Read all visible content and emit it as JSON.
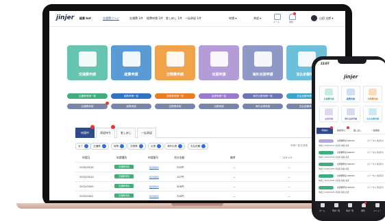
{
  "header": {
    "logo": "jinjer",
    "product": "経費 bot",
    "nav_active": "交通費ページ",
    "links": [
      "交通費 1件",
      "経費申請 1件",
      "差し戻し 1件",
      "一括承認 1件"
    ],
    "user_menu": "申請 ▾",
    "mode_menu": "承認 ▾",
    "icon_captions": [
      "ホーム",
      "通知"
    ],
    "user_name": "山田 太郎 ▾"
  },
  "tiles": [
    {
      "label": "交通費申請",
      "list": "交通費申請一覧",
      "approve": "交通費承認",
      "color": "#66c4b0",
      "pill": "#3fae7e",
      "pill2": "#7a86a8",
      "icon": "train-icon"
    },
    {
      "label": "経費申請",
      "list": "経費申請一覧",
      "approve": "経費承認",
      "color": "#5a9bd6",
      "pill": "#2f72c4",
      "pill2": "#7a86a8",
      "icon": "camera-icon"
    },
    {
      "label": "交際費申請",
      "list": "交際費申請一覧",
      "approve": "交際費承認",
      "color": "#f0a24c",
      "pill": "#ea7d22",
      "pill2": "#7a86a8",
      "icon": "store-icon"
    },
    {
      "label": "出張申請",
      "list": "出張申請一覧",
      "approve": "出張承認",
      "color": "#b49cd8",
      "pill": "#9b79cc",
      "pill2": "#7a86a8",
      "icon": "briefcase-icon"
    },
    {
      "label": "海外出張申請",
      "list": "海外出張申請一覧",
      "approve": "海外出張承認",
      "color": "#8f98c6",
      "pill": "#6b76b3",
      "pill2": "#7a86a8",
      "icon": "plane-icon"
    },
    {
      "label": "支払依頼申請",
      "list": "支払依頼申請一覧",
      "approve": "支払依頼承認",
      "color": "#6cc0dc",
      "pill": "#3aa6cc",
      "pill2": "#7a86a8",
      "icon": "document-icon"
    }
  ],
  "tabs": [
    "申請中",
    "承認待ち",
    "差し戻し",
    "一括承認"
  ],
  "filters": [
    "全て",
    "交通費",
    "経費",
    "交際費",
    "出張",
    "海外出張",
    "支払依頼"
  ],
  "filter_counts": [
    "4",
    "4",
    "",
    "",
    "",
    "",
    ""
  ],
  "search_placeholder": "申請一覧を検索",
  "table": {
    "headers": [
      "申請日",
      "申請種別",
      "申請番号",
      "合計金額",
      "備考",
      "コメント"
    ],
    "rows": [
      {
        "date": "2022/03/14",
        "type": "交通費申請",
        "no": "000000",
        "amount": "530円",
        "memo": "—",
        "comment": "—"
      },
      {
        "date": "2022/03/10",
        "type": "交通費申請",
        "no": "000000",
        "amount": "157円",
        "memo": "—",
        "comment": "—"
      },
      {
        "date": "2022/03/05",
        "type": "交通費申請",
        "no": "000000",
        "amount": "308円",
        "memo": "—",
        "comment": "—"
      },
      {
        "date": "2022/03/01",
        "type": "交通費申請",
        "no": "000000",
        "amount": "326円",
        "memo": "—",
        "comment": "—"
      }
    ]
  },
  "phone": {
    "time": "22:07",
    "logo": "jinjer",
    "tiles": [
      {
        "label": "交通費申請",
        "color": "#3fae7e"
      },
      {
        "label": "経費申請",
        "color": "#2f72c4"
      },
      {
        "label": "交際費申請",
        "color": "#ea7d22"
      },
      {
        "label": "出張申請",
        "color": "#9b79cc"
      },
      {
        "label": "海外出張申請",
        "color": "#6b76b3"
      },
      {
        "label": "支払依頼申請",
        "color": "#3aa6cc"
      }
    ],
    "tabs": [
      "申請中",
      "承認待ち",
      "差し戻し",
      "一括承認"
    ],
    "rows": [
      {
        "title": "交通費申請 000001",
        "meta": "申請日 2022/03/14  承認者 佐藤 太郎",
        "status": "ステータス 承認待ち"
      },
      {
        "title": "交通費申請 000002",
        "meta": "申請日 2022/03/10  承認者 佐藤 太郎",
        "status": "ステータス 承認待ち"
      },
      {
        "title": "交通費申請 000003",
        "meta": "申請日 2022/03/05  承認者 佐藤 太郎",
        "status": "ステータス 承認待ち"
      },
      {
        "title": "交通費申請 000004",
        "meta": "申請日 2022/03/01  承認者 佐藤 太郎",
        "status": "ステータス 承認待ち"
      },
      {
        "title": "交通費申請 000005",
        "meta": "申請日 2022/02/25  承認者 佐藤 太郎",
        "status": "ステータス 承認待ち"
      }
    ],
    "nav": [
      "ホーム",
      "申請一覧",
      "承認一覧",
      "通知",
      "メニュー"
    ]
  }
}
